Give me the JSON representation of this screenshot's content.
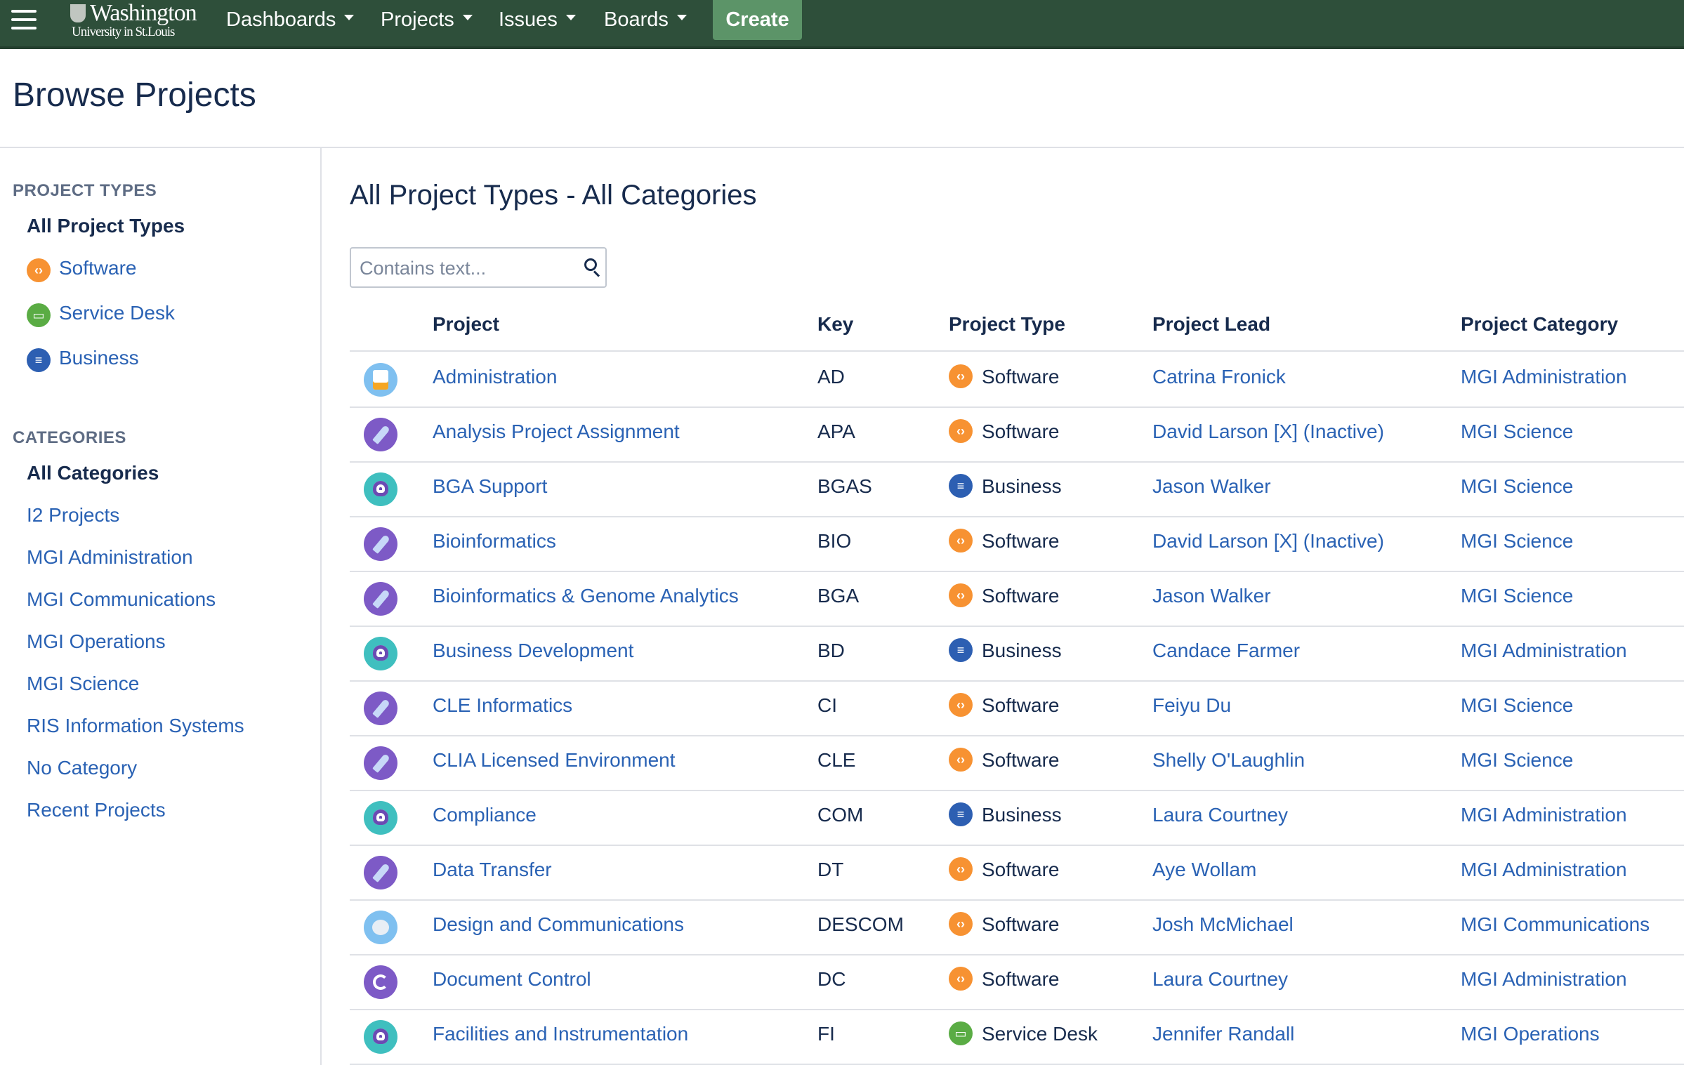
{
  "header": {
    "logo_line1": "Washington",
    "logo_line2": "University in St.Louis",
    "nav": [
      "Dashboards",
      "Projects",
      "Issues",
      "Boards"
    ],
    "create_label": "Create",
    "bg_color": "#2e4f3a",
    "create_color": "#5c9468"
  },
  "page_title": "Browse Projects",
  "sidebar": {
    "types_heading": "PROJECT TYPES",
    "types": [
      {
        "label": "All Project Types",
        "icon": ""
      },
      {
        "label": "Software",
        "icon": "software-icon"
      },
      {
        "label": "Service Desk",
        "icon": "service-desk-icon"
      },
      {
        "label": "Business",
        "icon": "business-icon"
      }
    ],
    "categories_heading": "CATEGORIES",
    "categories": [
      "All Categories",
      "I2 Projects",
      "MGI Administration",
      "MGI Communications",
      "MGI Operations",
      "MGI Science",
      "RIS Information Systems",
      "No Category",
      "Recent Projects"
    ]
  },
  "main": {
    "title": "All Project Types - All Categories",
    "search_placeholder": "Contains text...",
    "columns": [
      "Project",
      "Key",
      "Project Type",
      "Project Lead",
      "Project Category"
    ],
    "rows": [
      {
        "avatar": "pencil",
        "project": "Administration",
        "key": "AD",
        "type": "Software",
        "lead": "Catrina Fronick",
        "category": "MGI Administration"
      },
      {
        "avatar": "rocket",
        "project": "Analysis Project Assignment",
        "key": "APA",
        "type": "Software",
        "lead": "David Larson [X] (Inactive)",
        "category": "MGI Science"
      },
      {
        "avatar": "monster",
        "project": "BGA Support",
        "key": "BGAS",
        "type": "Business",
        "lead": "Jason Walker",
        "category": "MGI Science"
      },
      {
        "avatar": "rocket",
        "project": "Bioinformatics",
        "key": "BIO",
        "type": "Software",
        "lead": "David Larson [X] (Inactive)",
        "category": "MGI Science"
      },
      {
        "avatar": "rocket",
        "project": "Bioinformatics & Genome Analytics",
        "key": "BGA",
        "type": "Software",
        "lead": "Jason Walker",
        "category": "MGI Science"
      },
      {
        "avatar": "monster",
        "project": "Business Development",
        "key": "BD",
        "type": "Business",
        "lead": "Candace Farmer",
        "category": "MGI Administration"
      },
      {
        "avatar": "rocket",
        "project": "CLE Informatics",
        "key": "CI",
        "type": "Software",
        "lead": "Feiyu Du",
        "category": "MGI Science"
      },
      {
        "avatar": "rocket",
        "project": "CLIA Licensed Environment",
        "key": "CLE",
        "type": "Software",
        "lead": "Shelly O'Laughlin",
        "category": "MGI Science"
      },
      {
        "avatar": "monster",
        "project": "Compliance",
        "key": "COM",
        "type": "Business",
        "lead": "Laura Courtney",
        "category": "MGI Administration"
      },
      {
        "avatar": "rocket",
        "project": "Data Transfer",
        "key": "DT",
        "type": "Software",
        "lead": "Aye Wollam",
        "category": "MGI Administration"
      },
      {
        "avatar": "koala",
        "project": "Design and Communications",
        "key": "DESCOM",
        "type": "Software",
        "lead": "Josh McMichael",
        "category": "MGI Communications"
      },
      {
        "avatar": "sync",
        "project": "Document Control",
        "key": "DC",
        "type": "Software",
        "lead": "Laura Courtney",
        "category": "MGI Administration"
      },
      {
        "avatar": "monster",
        "project": "Facilities and Instrumentation",
        "key": "FI",
        "type": "Service Desk",
        "lead": "Jennifer Randall",
        "category": "MGI Operations"
      }
    ]
  },
  "colors": {
    "link": "#2a62b4",
    "software": "#f79232",
    "service_desk": "#5aac44",
    "business": "#2d5fb2"
  }
}
